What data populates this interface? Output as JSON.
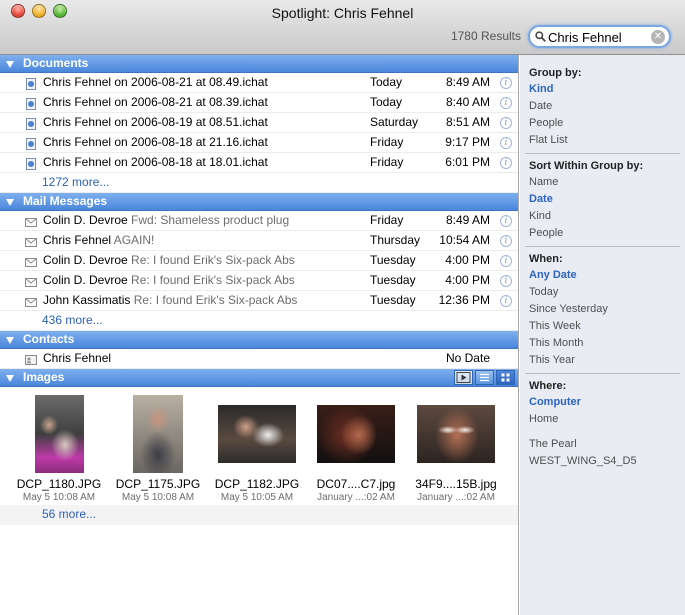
{
  "window": {
    "title": "Spotlight: Chris Fehnel",
    "results_count": "1780 Results"
  },
  "search": {
    "value": "Chris Fehnel"
  },
  "groups": {
    "documents": {
      "label": "Documents",
      "rows": [
        {
          "name": "Chris Fehnel on 2006-08-21 at 08.49.ichat",
          "day": "Today",
          "time": "8:49 AM"
        },
        {
          "name": "Chris Fehnel on 2006-08-21 at 08.39.ichat",
          "day": "Today",
          "time": "8:40 AM"
        },
        {
          "name": "Chris Fehnel on 2006-08-19 at 08.51.ichat",
          "day": "Saturday",
          "time": "8:51 AM"
        },
        {
          "name": "Chris Fehnel on 2006-08-18 at 21.16.ichat",
          "day": "Friday",
          "time": "9:17 PM"
        },
        {
          "name": "Chris Fehnel on 2006-08-18 at 18.01.ichat",
          "day": "Friday",
          "time": "6:01 PM"
        }
      ],
      "more": "1272 more..."
    },
    "mail": {
      "label": "Mail Messages",
      "rows": [
        {
          "from": "Colin D. Devroe",
          "subject": "Fwd: Shameless product plug",
          "day": "Friday",
          "time": "8:49 AM"
        },
        {
          "from": "Chris Fehnel",
          "subject": "AGAIN!",
          "day": "Thursday",
          "time": "10:54 AM"
        },
        {
          "from": "Colin D. Devroe",
          "subject": "Re: I found Erik's Six-pack Abs",
          "day": "Tuesday",
          "time": "4:00 PM"
        },
        {
          "from": "Colin D. Devroe",
          "subject": "Re: I found Erik's Six-pack Abs",
          "day": "Tuesday",
          "time": "4:00 PM"
        },
        {
          "from": "John Kassimatis",
          "subject": "Re: I found Erik's Six-pack Abs",
          "day": "Tuesday",
          "time": "12:36 PM"
        }
      ],
      "more": "436 more..."
    },
    "contacts": {
      "label": "Contacts",
      "rows": [
        {
          "name": "Chris Fehnel",
          "day": "No Date"
        }
      ]
    },
    "images": {
      "label": "Images",
      "items": [
        {
          "name": "DCP_1180.JPG",
          "date": "May 5 10:08 AM"
        },
        {
          "name": "DCP_1175.JPG",
          "date": "May 5 10:08 AM"
        },
        {
          "name": "DCP_1182.JPG",
          "date": "May 5 10:05 AM"
        },
        {
          "name": "DC07....C7.jpg",
          "date": "January ...:02 AM"
        },
        {
          "name": "34F9....15B.jpg",
          "date": "January ...:02 AM"
        }
      ],
      "more": "56 more..."
    }
  },
  "sidebar": {
    "group_by": {
      "heading": "Group by:",
      "items": [
        "Kind",
        "Date",
        "People",
        "Flat List"
      ],
      "selected": "Kind"
    },
    "sort_by": {
      "heading": "Sort Within Group by:",
      "items": [
        "Name",
        "Date",
        "Kind",
        "People"
      ],
      "selected": "Date"
    },
    "when": {
      "heading": "When:",
      "items": [
        "Any Date",
        "Today",
        "Since Yesterday",
        "This Week",
        "This Month",
        "This Year"
      ],
      "selected": "Any Date"
    },
    "where": {
      "heading": "Where:",
      "items": [
        "Computer",
        "Home",
        "The Pearl",
        "WEST_WING_S4_D5"
      ],
      "selected": "Computer"
    }
  },
  "colors": {
    "header_blue": "#4a86dc",
    "link_blue": "#2c5fb8",
    "sidebar_bg": "#e9edf3"
  }
}
